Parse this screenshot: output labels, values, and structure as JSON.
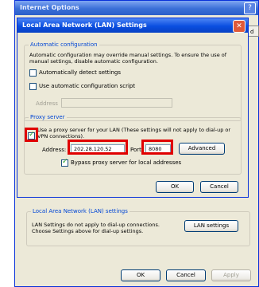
{
  "outer_window": {
    "title": "Internet Options",
    "help_button": "?",
    "lan_group": {
      "legend": "Local Area Network (LAN) settings",
      "text": "LAN Settings do not apply to dial-up connections. Choose Settings above for dial-up settings.",
      "button": "LAN settings"
    },
    "buttons": {
      "ok": "OK",
      "cancel": "Cancel",
      "apply": "Apply"
    },
    "side_tab": "d"
  },
  "dialog": {
    "title": "Local Area Network (LAN) Settings",
    "close_button": "✕",
    "auto_config": {
      "legend": "Automatic configuration",
      "description": "Automatic configuration may override manual settings. To ensure the use of manual settings, disable automatic configuration.",
      "detect_label": "Automatically detect settings",
      "detect_checked": false,
      "script_label": "Use automatic configuration script",
      "script_checked": false,
      "address_label": "Address",
      "address_value": ""
    },
    "proxy": {
      "legend": "Proxy server",
      "use_proxy_label": "Use a proxy server for your LAN (These settings will not apply to dial-up or VPN connections).",
      "use_proxy_checked": true,
      "address_label": "Address:",
      "address_value": "202.28.120.52",
      "port_label": "Port:",
      "port_value": "8080",
      "advanced_button": "Advanced",
      "bypass_label": "Bypass proxy server for local addresses",
      "bypass_checked": true
    },
    "buttons": {
      "ok": "OK",
      "cancel": "Cancel"
    }
  },
  "colors": {
    "highlight": "#e00000",
    "title_bar": "#0a4ee0"
  }
}
